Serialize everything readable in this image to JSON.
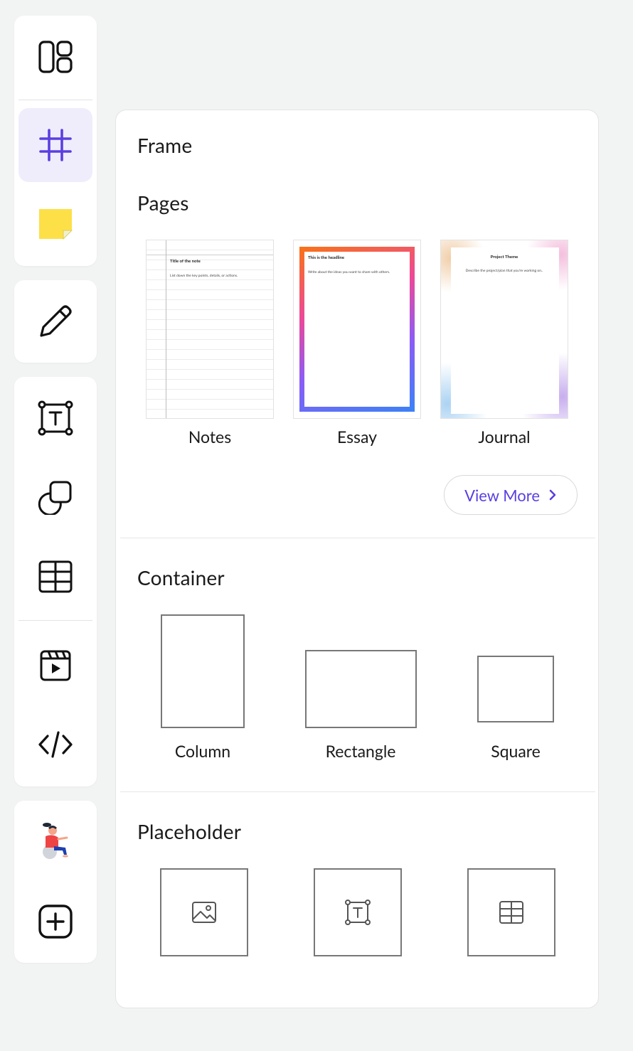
{
  "panel": {
    "title": "Frame",
    "pages": {
      "heading": "Pages",
      "items": [
        {
          "label": "Notes",
          "preview_title": "Title of the note",
          "preview_body": "List down the key points, details, or actions."
        },
        {
          "label": "Essay",
          "preview_title": "This is the headline",
          "preview_body": "Write about the ideas you want to share with others."
        },
        {
          "label": "Journal",
          "preview_title": "Project Theme",
          "preview_body": "Describe the project/plan that you're working on.."
        }
      ],
      "view_more": "View More"
    },
    "container": {
      "heading": "Container",
      "items": [
        {
          "label": "Column"
        },
        {
          "label": "Rectangle"
        },
        {
          "label": "Square"
        }
      ]
    },
    "placeholder": {
      "heading": "Placeholder",
      "items": [
        {
          "icon": "image-icon"
        },
        {
          "icon": "text-box-icon"
        },
        {
          "icon": "table-icon"
        }
      ]
    }
  },
  "toolbar": {
    "icons": [
      "layout-icon",
      "frame-icon",
      "sticky-note-icon",
      "pencil-icon",
      "text-box-icon",
      "shapes-icon",
      "table-icon",
      "video-icon",
      "code-icon",
      "avatar-illustration",
      "add-icon"
    ],
    "active": "frame-icon"
  },
  "colors": {
    "accent": "#5b3fe0",
    "active_bg": "#efedfb",
    "sticky": "#fde047"
  }
}
